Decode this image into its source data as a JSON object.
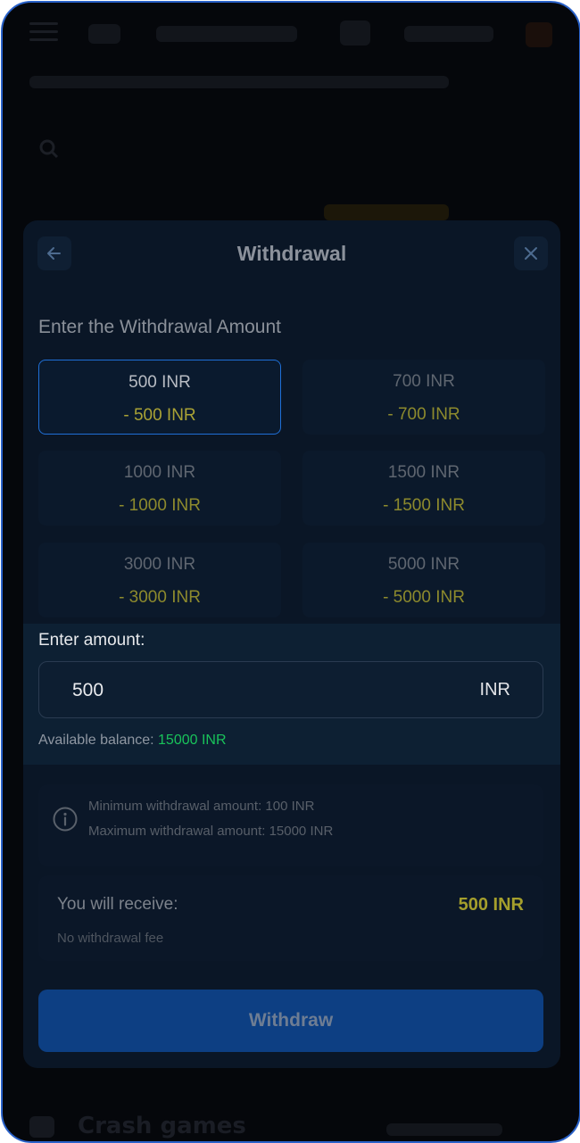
{
  "modal": {
    "title": "Withdrawal",
    "section_title": "Enter the Withdrawal Amount",
    "options": [
      {
        "amount": "500 INR",
        "deduction": "- 500 INR",
        "selected": true
      },
      {
        "amount": "700 INR",
        "deduction": "- 700 INR",
        "selected": false
      },
      {
        "amount": "1000 INR",
        "deduction": "- 1000 INR",
        "selected": false
      },
      {
        "amount": "1500 INR",
        "deduction": "- 1500 INR",
        "selected": false
      },
      {
        "amount": "3000 INR",
        "deduction": "- 3000 INR",
        "selected": false
      },
      {
        "amount": "5000 INR",
        "deduction": "- 5000 INR",
        "selected": false
      }
    ],
    "amount_input": {
      "label": "Enter amount:",
      "value": "500",
      "currency": "INR",
      "balance_label": "Available balance:",
      "balance_value": "15000 INR"
    },
    "limits": {
      "min": "Minimum withdrawal amount: 100 INR",
      "max": "Maximum withdrawal amount: 15000 INR"
    },
    "receive": {
      "label": "You will receive:",
      "value": "500 INR",
      "fee_note": "No withdrawal fee"
    },
    "withdraw_button": "Withdraw"
  },
  "background": {
    "section_heading": "Crash games"
  },
  "colors": {
    "accent_blue": "#1f6fd6",
    "deduction_yellow": "#a9a235",
    "balance_green": "#19c25a"
  }
}
